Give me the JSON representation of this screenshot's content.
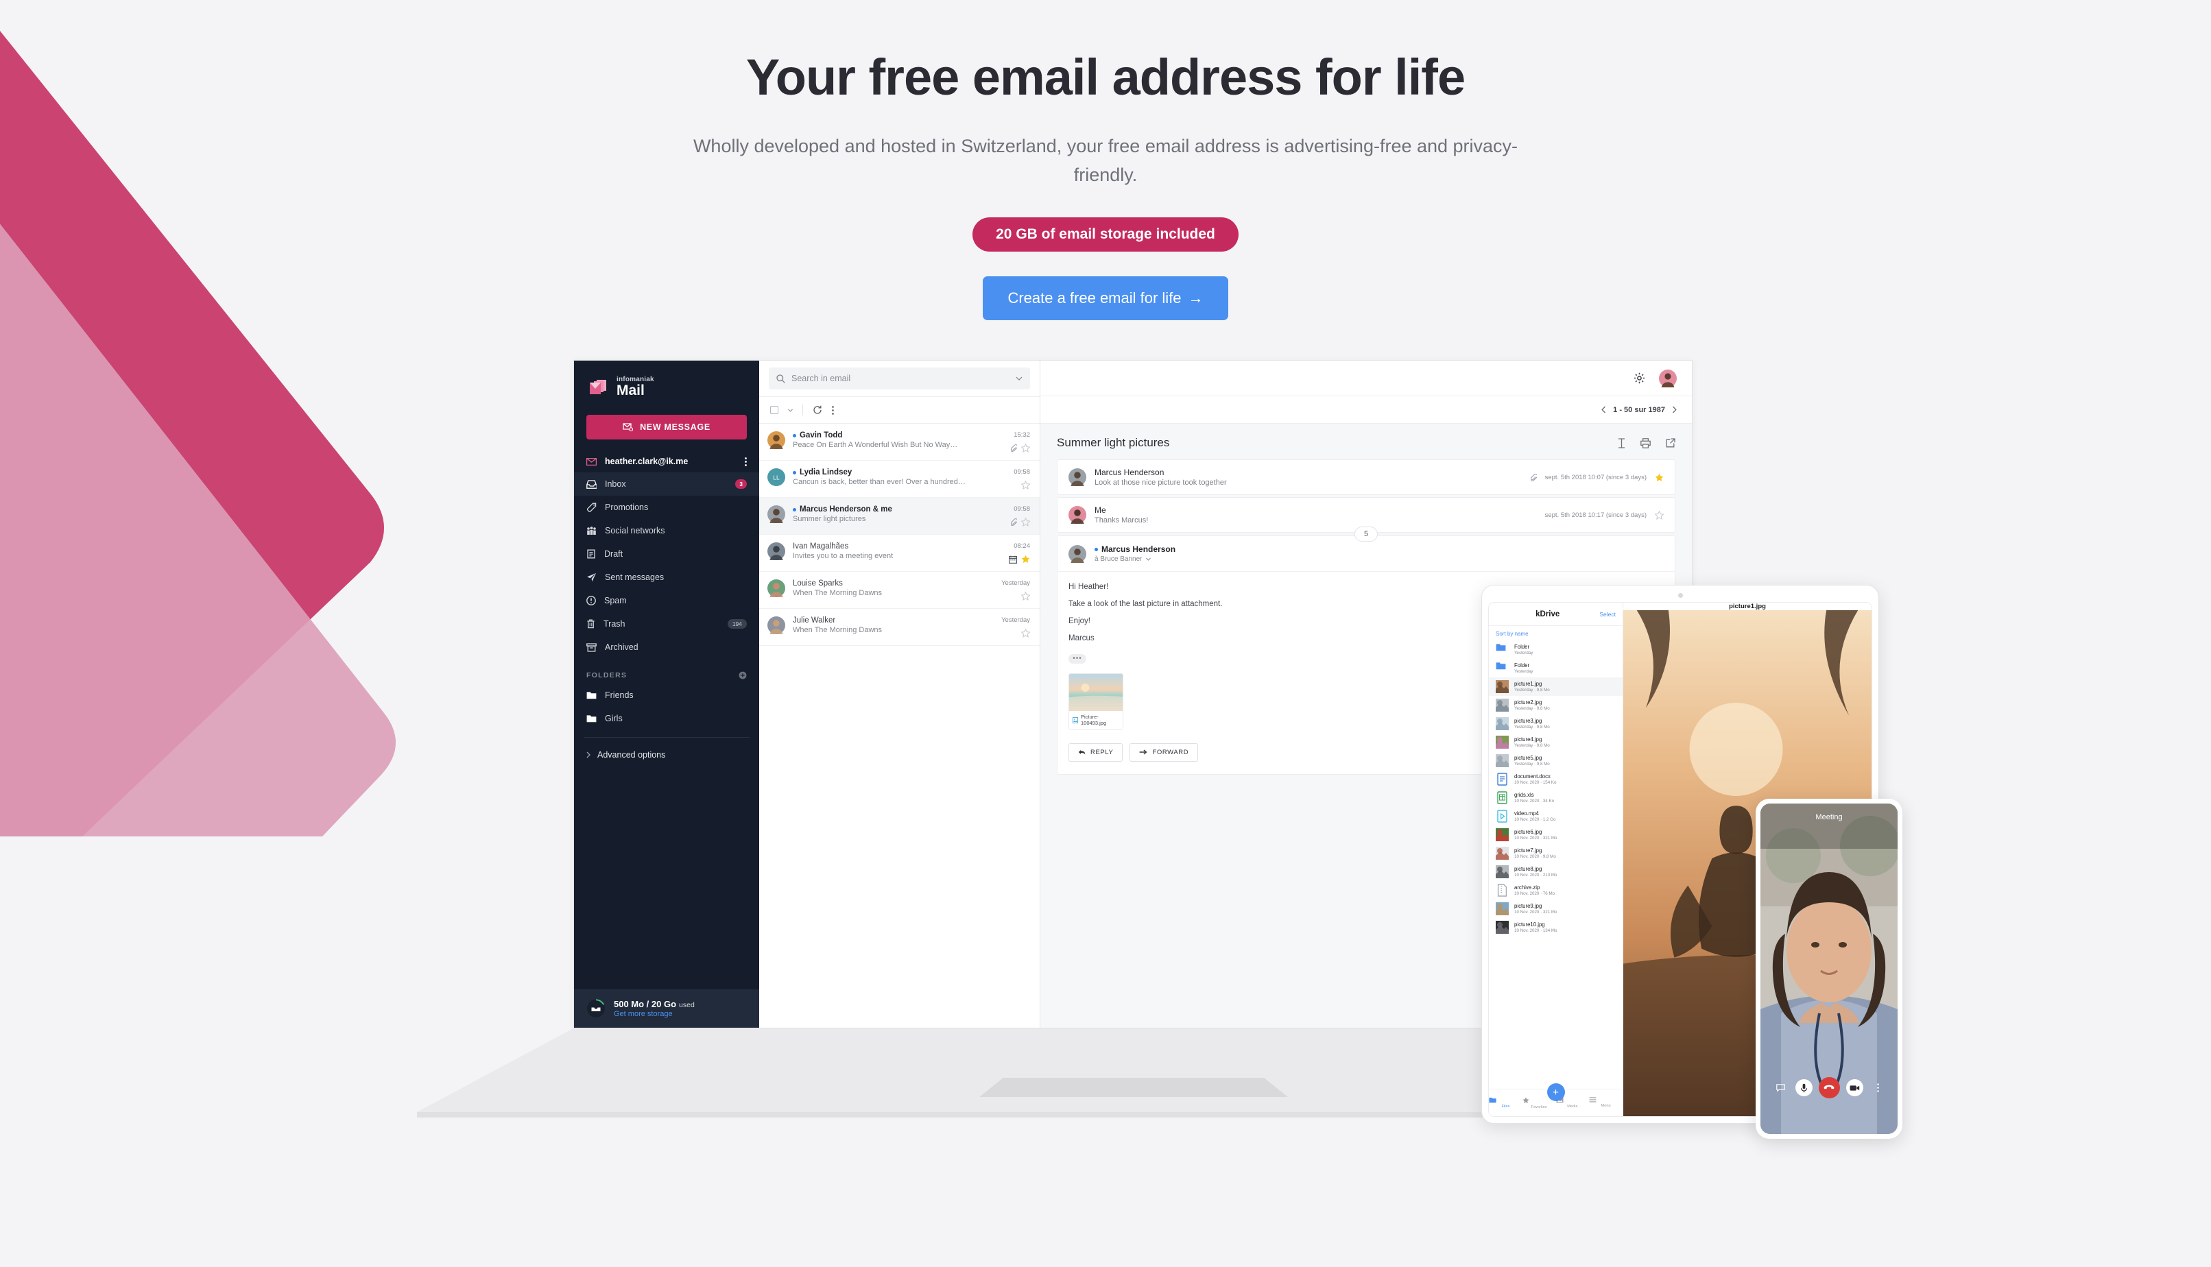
{
  "hero": {
    "title": "Your free email address for life",
    "subtitle": "Wholly developed and hosted in Switzerland, your free email address is advertising-free and privacy-friendly.",
    "badge": "20 GB of email storage included",
    "cta": "Create a free email for life",
    "cta_arrow": "→"
  },
  "colors": {
    "brand_pink": "#c42a5e",
    "brand_pink_light": "#dd9fb8",
    "accent_blue": "#4a90f0",
    "sidebar_bg": "#151d2c",
    "page_bg": "#f4f4f6",
    "star_gold": "#f5c518",
    "hangup_red": "#d93c38"
  },
  "mail": {
    "brand": {
      "sup": "infomaniak",
      "name": "Mail",
      "icon": "mail-logo-icon"
    },
    "new_message": {
      "label": "NEW MESSAGE",
      "icon": "new-message-icon"
    },
    "account": {
      "email": "heather.clark@ik.me",
      "icon": "envelope-icon",
      "menu_icon": "more-vertical-icon"
    },
    "nav": [
      {
        "label": "Inbox",
        "icon": "inbox-icon",
        "badge": "3",
        "badge_type": "pink",
        "active": true
      },
      {
        "label": "Promotions",
        "icon": "tag-icon",
        "badge": "",
        "badge_type": "",
        "active": false
      },
      {
        "label": "Social networks",
        "icon": "people-icon",
        "badge": "",
        "badge_type": "",
        "active": false
      },
      {
        "label": "Draft",
        "icon": "draft-icon",
        "badge": "",
        "badge_type": "",
        "active": false
      },
      {
        "label": "Sent messages",
        "icon": "send-icon",
        "badge": "",
        "badge_type": "",
        "active": false
      },
      {
        "label": "Spam",
        "icon": "spam-icon",
        "badge": "",
        "badge_type": "",
        "active": false
      },
      {
        "label": "Trash",
        "icon": "trash-icon",
        "badge": "194",
        "badge_type": "grey",
        "active": false
      },
      {
        "label": "Archived",
        "icon": "archive-icon",
        "badge": "",
        "badge_type": "",
        "active": false
      }
    ],
    "folders_header": {
      "label": "FOLDERS",
      "add_icon": "plus-circle-icon"
    },
    "folders": [
      {
        "label": "Friends",
        "icon": "folder-icon"
      },
      {
        "label": "Girls",
        "icon": "folder-icon"
      }
    ],
    "advanced_options": {
      "label": "Advanced options",
      "icon": "chevron-right-icon"
    },
    "storage": {
      "icon": "inbox-storage-icon",
      "amount": "500 Mo / 20 Go",
      "used_label": "used",
      "link": "Get more storage"
    },
    "search": {
      "placeholder": "Search in email",
      "icon": "search-icon",
      "chevron": "chevron-down-icon"
    },
    "list_tools": {
      "select_all": "select-all-checkbox",
      "dropdown": "chevron-down-icon",
      "refresh": "refresh-icon",
      "more": "more-vertical-icon"
    },
    "pagination": {
      "text": "1 - 50 sur 1987",
      "prev": "chevron-left-icon",
      "next": "chevron-right-icon"
    },
    "topbar": {
      "settings": "gear-icon",
      "avatar": "user-avatar"
    },
    "messages": [
      {
        "name": "Gavin Todd",
        "preview": "Peace On Earth A Wonderful Wish But No Way…",
        "time": "15:32",
        "unread": true,
        "attachment": true,
        "calendar": false,
        "starred": false,
        "selected": false,
        "avatar_a": "#d99a4e",
        "avatar_b": "#6b4a2c",
        "initials": ""
      },
      {
        "name": "Lydia Lindsey",
        "preview": "Cancun is back, better than ever! Over a hundred…",
        "time": "09:58",
        "unread": true,
        "attachment": false,
        "calendar": false,
        "starred": false,
        "selected": false,
        "avatar_a": "#4a9aa8",
        "avatar_b": "#4a9aa8",
        "initials": "LL"
      },
      {
        "name": "Marcus Henderson & me",
        "preview": "Summer light pictures",
        "time": "09:58",
        "unread": true,
        "attachment": true,
        "calendar": false,
        "starred": false,
        "selected": true,
        "avatar_a": "#9aa0a8",
        "avatar_b": "#5a4636",
        "initials": ""
      },
      {
        "name": "Ivan Magalhães",
        "preview": "Invites you to a meeting event",
        "time": "08:24",
        "unread": false,
        "attachment": false,
        "calendar": true,
        "starred": true,
        "selected": false,
        "avatar_a": "#7d8a96",
        "avatar_b": "#3a3f47",
        "initials": ""
      },
      {
        "name": "Louise Sparks",
        "preview": "When The Morning Dawns",
        "time": "Yesterday",
        "unread": false,
        "attachment": false,
        "calendar": false,
        "starred": false,
        "selected": false,
        "avatar_a": "#6aa07a",
        "avatar_b": "#c98b74",
        "initials": ""
      },
      {
        "name": "Julie Walker",
        "preview": "When The Morning Dawns",
        "time": "Yesterday",
        "unread": false,
        "attachment": false,
        "calendar": false,
        "starred": false,
        "selected": false,
        "avatar_a": "#8e93a0",
        "avatar_b": "#c9a07a",
        "initials": ""
      }
    ],
    "reader": {
      "subject": "Summer light pictures",
      "actions": {
        "text_size": "text-size-icon",
        "print": "print-icon",
        "open_external": "open-external-icon"
      },
      "thread": [
        {
          "name": "Marcus Henderson",
          "snippet": "Look at those nice picture took together",
          "meta": "sept. 5th 2018 10:07 (since 3 days)",
          "attachment": true,
          "starred": true
        },
        {
          "name": "Me",
          "snippet": "Thanks Marcus!",
          "meta": "sept. 5th 2018 10:17 (since 3 days)",
          "attachment": false,
          "starred": false
        }
      ],
      "collapsed_count": "5",
      "open_message": {
        "sender": "Marcus Henderson",
        "recipient": "à Bruce Banner",
        "recipient_chevron": "chevron-down-icon",
        "paragraphs": [
          "Hi Heather!",
          "Take a look of the last picture in attachment.",
          "Enjoy!",
          "Marcus"
        ],
        "signature_toggle": "•••",
        "attachment": {
          "filename": "Picture-100493.jpg",
          "icon": "image-file-icon"
        },
        "reply_label": "REPLY",
        "reply_icon": "reply-icon",
        "forward_label": "FORWARD",
        "forward_icon": "forward-icon"
      }
    }
  },
  "kdrive": {
    "title": "kDrive",
    "select_label": "Select",
    "sort_label": "Sort by name",
    "preview_title": "picture1.jpg",
    "files": [
      {
        "name": "Folder",
        "meta": "Yesterday",
        "type": "folder",
        "selected": false
      },
      {
        "name": "Folder",
        "meta": "Yesterday",
        "type": "folder",
        "selected": false
      },
      {
        "name": "picture1.jpg",
        "meta": "Yesterday · 9,8 Mo",
        "type": "image",
        "selected": true,
        "c1": "#b98a63",
        "c2": "#6b4a33"
      },
      {
        "name": "picture2.jpg",
        "meta": "Yesterday · 9,8 Mo",
        "type": "image",
        "selected": false,
        "c1": "#b9c0c6",
        "c2": "#7d8a93"
      },
      {
        "name": "picture3.jpg",
        "meta": "Yesterday · 9,8 Mo",
        "type": "image",
        "selected": false,
        "c1": "#c9d6de",
        "c2": "#8aa3b4"
      },
      {
        "name": "picture4.jpg",
        "meta": "Yesterday · 9,8 Mo",
        "type": "image",
        "selected": false,
        "c1": "#7d9a52",
        "c2": "#c97ab0"
      },
      {
        "name": "picture5.jpg",
        "meta": "Yesterday · 9,8 Mo",
        "type": "image",
        "selected": false,
        "c1": "#c2c9cf",
        "c2": "#9aa4ae"
      },
      {
        "name": "document.docx",
        "meta": "10 Nov. 2020 · 154 Ko",
        "type": "doc",
        "selected": false
      },
      {
        "name": "grids.xls",
        "meta": "10 Nov. 2020 · 34 Ko",
        "type": "xls",
        "selected": false
      },
      {
        "name": "video.mp4",
        "meta": "10 Nov. 2020 · 1.2 Go",
        "type": "video",
        "selected": false
      },
      {
        "name": "picture6.jpg",
        "meta": "10 Nov. 2020 · 321 Mo",
        "type": "image",
        "selected": false,
        "c1": "#4d7a3a",
        "c2": "#cc3b33"
      },
      {
        "name": "picture7.jpg",
        "meta": "10 Nov. 2020 · 9,8 Mo",
        "type": "image",
        "selected": false,
        "c1": "#e0e2e4",
        "c2": "#b05a4a"
      },
      {
        "name": "picture8.jpg",
        "meta": "10 Nov. 2020 · 213 Mo",
        "type": "image",
        "selected": false,
        "c1": "#b3b8bd",
        "c2": "#55595e"
      },
      {
        "name": "archive.zip",
        "meta": "10 Nov. 2020 · 76 Mo",
        "type": "zip",
        "selected": false
      },
      {
        "name": "picture9.jpg",
        "meta": "10 Nov. 2020 · 321 Mo",
        "type": "image",
        "selected": false,
        "c1": "#7fa8c4",
        "c2": "#b9935f"
      },
      {
        "name": "picture10.jpg",
        "meta": "10 Nov. 2020 · 134 Mo",
        "type": "image",
        "selected": false,
        "c1": "#2e2e33",
        "c2": "#6b6b72"
      }
    ],
    "tabs": [
      {
        "label": "Files",
        "icon": "files-icon",
        "active": true
      },
      {
        "label": "Favorites",
        "icon": "star-icon",
        "active": false
      },
      {
        "label": "Media",
        "icon": "media-icon",
        "active": false
      },
      {
        "label": "Menu",
        "icon": "menu-icon",
        "active": false
      }
    ],
    "fab": {
      "label": "+",
      "icon": "plus-icon"
    }
  },
  "phone": {
    "title": "Meeting",
    "controls": [
      {
        "name": "chat-icon",
        "style": "flat"
      },
      {
        "name": "microphone-icon",
        "style": "white"
      },
      {
        "name": "hangup-icon",
        "style": "hang"
      },
      {
        "name": "video-camera-icon",
        "style": "white"
      },
      {
        "name": "more-vertical-icon",
        "style": "flat"
      }
    ]
  }
}
